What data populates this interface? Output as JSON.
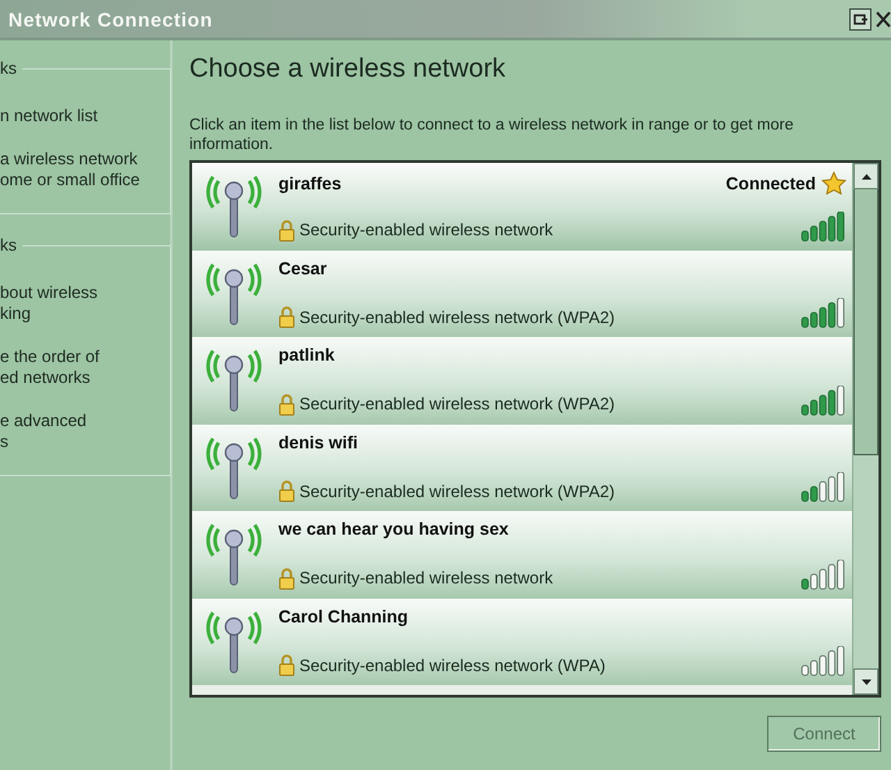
{
  "window": {
    "title": "Network Connection"
  },
  "sidebar": {
    "groups": [
      {
        "heading": "ks",
        "items": [
          "n network list",
          "a wireless network\nome or small office"
        ]
      },
      {
        "heading": "ks",
        "items": [
          "bout wireless\nking",
          "e the order of\ned networks",
          "e advanced\ns"
        ]
      }
    ]
  },
  "heading": "Choose a wireless network",
  "description": "Click an item in the list below to connect to a wireless network in range or to get more information.",
  "networks": [
    {
      "name": "giraffes",
      "security": "Security-enabled wireless network",
      "status": "Connected",
      "connected": true,
      "signal": {
        "level": 1
      }
    },
    {
      "name": "Cesar",
      "security": "Security-enabled wireless network (WPA2)",
      "connected": false,
      "signal": {
        "level": 0.8
      }
    },
    {
      "name": "patlink",
      "security": "Security-enabled wireless network (WPA2)",
      "connected": false,
      "signal": {
        "level": 0.8
      }
    },
    {
      "name": "denis wifi",
      "security": "Security-enabled wireless network (WPA2)",
      "connected": false,
      "signal": {
        "level": 0.4
      }
    },
    {
      "name": "we can hear you having sex",
      "security": "Security-enabled wireless network",
      "connected": false,
      "signal": {
        "level": 0.2
      }
    },
    {
      "name": "Carol Channing",
      "security": "Security-enabled wireless network (WPA)",
      "connected": false
    }
  ],
  "connect_button": {
    "label": "Connect",
    "disabled": true
  }
}
